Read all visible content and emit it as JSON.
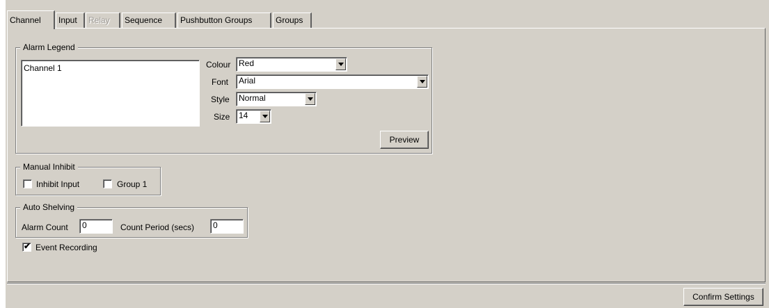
{
  "tabs": [
    {
      "label": "Channel",
      "state": "active"
    },
    {
      "label": "Input",
      "state": "normal"
    },
    {
      "label": "Relay",
      "state": "disabled"
    },
    {
      "label": "Sequence",
      "state": "normal"
    },
    {
      "label": "Pushbutton Groups",
      "state": "normal"
    },
    {
      "label": "Groups",
      "state": "normal"
    }
  ],
  "alarm_legend": {
    "title": "Alarm Legend",
    "text_value": "Channel 1",
    "colour_label": "Colour",
    "colour_value": "Red",
    "font_label": "Font",
    "font_value": "Arial",
    "style_label": "Style",
    "style_value": "Normal",
    "size_label": "Size",
    "size_value": "14",
    "preview_button": "Preview"
  },
  "manual_inhibit": {
    "title": "Manual Inhibit",
    "inhibit_input_label": "Inhibit Input",
    "inhibit_input_checked": false,
    "group1_label": "Group 1",
    "group1_checked": false
  },
  "auto_shelving": {
    "title": "Auto Shelving",
    "alarm_count_label": "Alarm Count",
    "alarm_count_value": "0",
    "count_period_label": "Count Period (secs)",
    "count_period_value": "0"
  },
  "event_recording": {
    "label": "Event Recording",
    "checked": true
  },
  "confirm_button": "Confirm Settings",
  "colors": {
    "face": "#d4d0c8",
    "disabled_text": "#a09d98"
  }
}
